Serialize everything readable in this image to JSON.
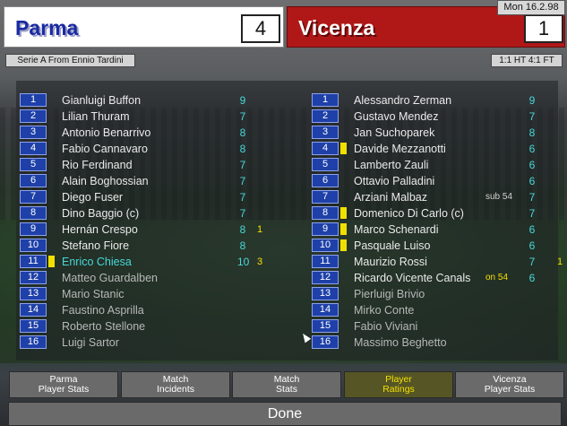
{
  "header": {
    "home_team": "Parma",
    "home_score": "4",
    "away_team": "Vicenza",
    "away_score": "1",
    "date": "Mon 16.2.98",
    "venue": "Serie A From Ennio Tardini",
    "halftime": "1:1 HT 4:1 FT"
  },
  "colors": {
    "home_bg": "#ffffff",
    "home_text": "#1a2aa0",
    "away_bg": "#b01818",
    "away_text": "#ffffff",
    "rating": "#48d8d8",
    "goals": "#f4e000",
    "card": "#f0e000"
  },
  "home_players": [
    {
      "num": "1",
      "name": "Gianluigi Buffon",
      "rating": "9",
      "goals": "",
      "note": "",
      "card": false,
      "sub": false,
      "highlight": false
    },
    {
      "num": "2",
      "name": "Lilian Thuram",
      "rating": "7",
      "goals": "",
      "note": "",
      "card": false,
      "sub": false,
      "highlight": false
    },
    {
      "num": "3",
      "name": "Antonio Benarrivo",
      "rating": "8",
      "goals": "",
      "note": "",
      "card": false,
      "sub": false,
      "highlight": false
    },
    {
      "num": "4",
      "name": "Fabio Cannavaro",
      "rating": "8",
      "goals": "",
      "note": "",
      "card": false,
      "sub": false,
      "highlight": false
    },
    {
      "num": "5",
      "name": "Rio Ferdinand",
      "rating": "7",
      "goals": "",
      "note": "",
      "card": false,
      "sub": false,
      "highlight": false
    },
    {
      "num": "6",
      "name": "Alain Boghossian",
      "rating": "7",
      "goals": "",
      "note": "",
      "card": false,
      "sub": false,
      "highlight": false
    },
    {
      "num": "7",
      "name": "Diego Fuser",
      "rating": "7",
      "goals": "",
      "note": "",
      "card": false,
      "sub": false,
      "highlight": false
    },
    {
      "num": "8",
      "name": "Dino Baggio (c)",
      "rating": "7",
      "goals": "",
      "note": "",
      "card": false,
      "sub": false,
      "highlight": false
    },
    {
      "num": "9",
      "name": "Hernán Crespo",
      "rating": "8",
      "goals": "1",
      "note": "",
      "card": false,
      "sub": false,
      "highlight": false
    },
    {
      "num": "10",
      "name": "Stefano Fiore",
      "rating": "8",
      "goals": "",
      "note": "",
      "card": false,
      "sub": false,
      "highlight": false
    },
    {
      "num": "11",
      "name": "Enrico Chiesa",
      "rating": "10",
      "goals": "3",
      "note": "",
      "card": true,
      "sub": false,
      "highlight": true
    },
    {
      "num": "12",
      "name": "Matteo Guardalben",
      "rating": "",
      "goals": "",
      "note": "",
      "card": false,
      "sub": true,
      "highlight": false
    },
    {
      "num": "13",
      "name": "Mario Stanic",
      "rating": "",
      "goals": "",
      "note": "",
      "card": false,
      "sub": true,
      "highlight": false
    },
    {
      "num": "14",
      "name": "Faustino Asprilla",
      "rating": "",
      "goals": "",
      "note": "",
      "card": false,
      "sub": true,
      "highlight": false
    },
    {
      "num": "15",
      "name": "Roberto Stellone",
      "rating": "",
      "goals": "",
      "note": "",
      "card": false,
      "sub": true,
      "highlight": false
    },
    {
      "num": "16",
      "name": "Luigi Sartor",
      "rating": "",
      "goals": "",
      "note": "",
      "card": false,
      "sub": true,
      "highlight": false
    }
  ],
  "away_players": [
    {
      "num": "1",
      "name": "Alessandro Zerman",
      "rating": "9",
      "goals": "",
      "note": "",
      "card": false,
      "sub": false
    },
    {
      "num": "2",
      "name": "Gustavo Mendez",
      "rating": "7",
      "goals": "",
      "note": "",
      "card": false,
      "sub": false
    },
    {
      "num": "3",
      "name": "Jan Suchoparek",
      "rating": "8",
      "goals": "",
      "note": "",
      "card": false,
      "sub": false
    },
    {
      "num": "4",
      "name": "Davide Mezzanotti",
      "rating": "6",
      "goals": "",
      "note": "",
      "card": true,
      "sub": false
    },
    {
      "num": "5",
      "name": "Lamberto Zauli",
      "rating": "6",
      "goals": "",
      "note": "",
      "card": false,
      "sub": false
    },
    {
      "num": "6",
      "name": "Ottavio Palladini",
      "rating": "6",
      "goals": "",
      "note": "",
      "card": false,
      "sub": false
    },
    {
      "num": "7",
      "name": "Arziani Malbaz",
      "rating": "7",
      "goals": "",
      "note": "sub 54",
      "card": false,
      "sub": false
    },
    {
      "num": "8",
      "name": "Domenico Di Carlo (c)",
      "rating": "7",
      "goals": "",
      "note": "",
      "card": true,
      "sub": false
    },
    {
      "num": "9",
      "name": "Marco Schenardi",
      "rating": "6",
      "goals": "",
      "note": "",
      "card": true,
      "sub": false
    },
    {
      "num": "10",
      "name": "Pasquale Luiso",
      "rating": "6",
      "goals": "",
      "note": "",
      "card": true,
      "sub": false
    },
    {
      "num": "11",
      "name": "Maurizio Rossi",
      "rating": "7",
      "goals": "1",
      "note": "",
      "card": false,
      "sub": false
    },
    {
      "num": "12",
      "name": "Ricardo Vicente Canals",
      "rating": "6",
      "goals": "",
      "note": "on 54",
      "card": false,
      "sub": false
    },
    {
      "num": "13",
      "name": "Pierluigi Brivio",
      "rating": "",
      "goals": "",
      "note": "",
      "card": false,
      "sub": true
    },
    {
      "num": "14",
      "name": "Mirko Conte",
      "rating": "",
      "goals": "",
      "note": "",
      "card": false,
      "sub": true
    },
    {
      "num": "15",
      "name": "Fabio Viviani",
      "rating": "",
      "goals": "",
      "note": "",
      "card": false,
      "sub": true
    },
    {
      "num": "16",
      "name": "Massimo Beghetto",
      "rating": "",
      "goals": "",
      "note": "",
      "card": false,
      "sub": true
    }
  ],
  "tabs": [
    {
      "line1": "Parma",
      "line2": "Player Stats",
      "active": false
    },
    {
      "line1": "Match",
      "line2": "Incidents",
      "active": false
    },
    {
      "line1": "Match",
      "line2": "Stats",
      "active": false
    },
    {
      "line1": "Player",
      "line2": "Ratings",
      "active": true
    },
    {
      "line1": "Vicenza",
      "line2": "Player Stats",
      "active": false
    }
  ],
  "done_label": "Done"
}
